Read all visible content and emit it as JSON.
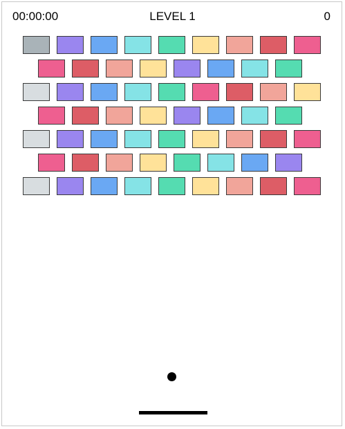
{
  "hud": {
    "timer": "00:00:00",
    "level": "LEVEL 1",
    "score": "0"
  },
  "palette": {
    "gray_dark": "#a9b3b8",
    "gray_light": "#d8dde0",
    "purple": "#9a86ef",
    "blue": "#6aa8f3",
    "cyan": "#85e3e6",
    "green": "#55dcb1",
    "yellow": "#ffe299",
    "salmon": "#f1a59a",
    "red": "#dd5d66",
    "pink": "#ee5f90"
  },
  "bricks": [
    [
      "gray_dark",
      "purple",
      "blue",
      "cyan",
      "green",
      "yellow",
      "salmon",
      "red",
      "pink"
    ],
    [
      "pink",
      "red",
      "salmon",
      "yellow",
      "purple",
      "blue",
      "cyan",
      "green"
    ],
    [
      "gray_light",
      "purple",
      "blue",
      "cyan",
      "green",
      "pink",
      "red",
      "salmon",
      "yellow"
    ],
    [
      "pink",
      "red",
      "salmon",
      "yellow",
      "purple",
      "blue",
      "cyan",
      "green"
    ],
    [
      "gray_light",
      "purple",
      "blue",
      "cyan",
      "green",
      "yellow",
      "salmon",
      "red",
      "pink"
    ],
    [
      "pink",
      "red",
      "salmon",
      "yellow",
      "green",
      "cyan",
      "blue",
      "purple"
    ],
    [
      "gray_light",
      "purple",
      "blue",
      "cyan",
      "green",
      "yellow",
      "salmon",
      "red",
      "pink"
    ]
  ]
}
